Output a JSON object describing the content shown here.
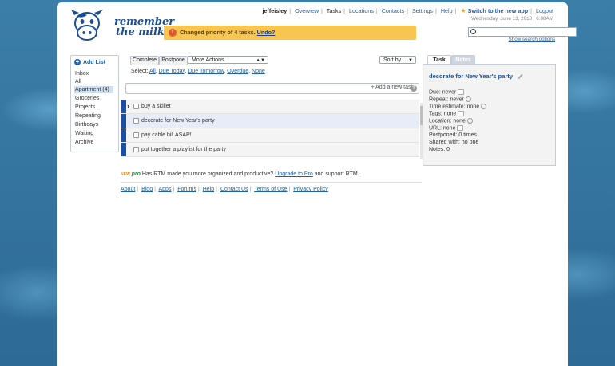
{
  "logo": {
    "line1": "remember",
    "line2": "the milk"
  },
  "topnav": {
    "user": "jeffeisley",
    "links": [
      "Overview",
      "Tasks",
      "Locations",
      "Contacts",
      "Settings",
      "Help"
    ],
    "current": "Tasks",
    "switch_app": "Switch to the new app",
    "logout": "Logout",
    "datetime": "Wednesday, June 13, 2018 | 6:08AM"
  },
  "search": {
    "value": "",
    "options_link": "Show search options"
  },
  "notice": {
    "text": "Changed priority of 4 tasks.",
    "undo": "Undo?"
  },
  "sidebar": {
    "add_list": "Add List",
    "items": [
      "Inbox",
      "All",
      "Apartment (4)",
      "Groceries",
      "Projects",
      "Repeating",
      "Birthdays",
      "Waiting",
      "Archive"
    ],
    "selected": "Apartment (4)"
  },
  "toolbar": {
    "complete": "Complete",
    "postpone": "Postpone",
    "more_actions": "More Actions...",
    "sort_by": "Sort by...",
    "select_label": "Select:",
    "select_links": [
      "All",
      "Due Today",
      "Due Tomorrow",
      "Overdue",
      "None"
    ]
  },
  "add_task": {
    "label": "+ Add a new task"
  },
  "tasks": [
    {
      "name": "buy a skillet",
      "priority": "1",
      "selected": false
    },
    {
      "name": "decorate for New Year's party",
      "priority": "1",
      "selected": true
    },
    {
      "name": "pay cable bill ASAP!",
      "priority": "1",
      "selected": false
    },
    {
      "name": "put together a playlist for the party",
      "priority": "1",
      "selected": false
    }
  ],
  "pro": {
    "new_badge": "NEW",
    "pro_badge": "pro",
    "text_before": "Has RTM made you more organized and productive?",
    "link": "Upgrade to Pro",
    "text_after": "and support RTM."
  },
  "footer": {
    "links": [
      "About",
      "Blog",
      "Apps",
      "Forums",
      "Help",
      "Contact Us",
      "Terms of Use",
      "Privacy Policy"
    ]
  },
  "detail": {
    "tabs": [
      "Task",
      "Notes"
    ],
    "active_tab": "Task",
    "title": "decorate for New Year's party",
    "fields": [
      "Due: never",
      "Repeat: never",
      "Time estimate: none",
      "Tags: none",
      "Location: none",
      "URL: none",
      "Postponed: 0 times",
      "Shared with: no one",
      "Notes: 0"
    ]
  },
  "colors": {
    "priority1": "#1a4fa3",
    "notice_bg": "#f7c550",
    "link": "#1f5fa8"
  }
}
